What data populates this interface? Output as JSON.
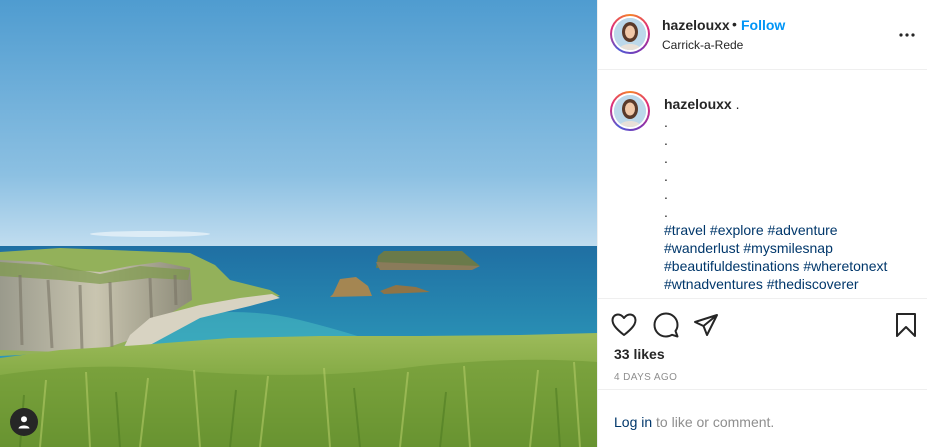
{
  "post": {
    "username": "hazelouxx",
    "follow_label": "Follow",
    "separator": "•",
    "location": "Carrick-a-Rede"
  },
  "caption": {
    "username": "hazelouxx",
    "first_line": " .",
    "dots": [
      ".",
      ".",
      ".",
      ".",
      ".",
      "."
    ],
    "hashtags": [
      [
        "#travel",
        "#explore",
        "#adventure"
      ],
      [
        "#wanderlust",
        "#mysmilesnap"
      ],
      [
        "#beautifuldestinations",
        "#wheretonext"
      ],
      [
        "#wtnadventures",
        "#thediscoverer"
      ]
    ]
  },
  "engagement": {
    "likes": "33 likes",
    "timestamp": "4 DAYS AGO"
  },
  "login": {
    "link_label": "Log in",
    "rest": " to like or comment."
  },
  "icons": {
    "like": "heart-icon",
    "comment": "comment-icon",
    "share": "share-icon",
    "save": "bookmark-icon",
    "more": "more-options-icon",
    "tag": "user-tag-icon"
  },
  "colors": {
    "link": "#0095f6",
    "hashtag": "#00376b",
    "muted": "#8e8e8e"
  }
}
